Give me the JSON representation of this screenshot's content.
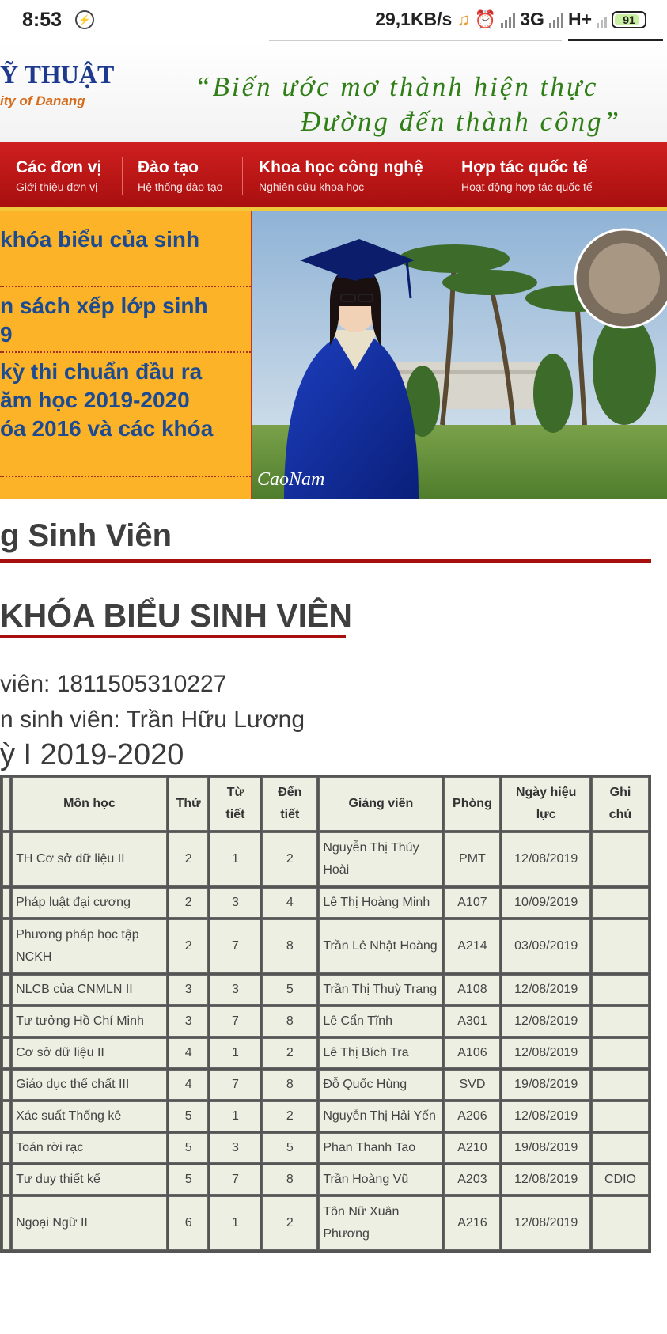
{
  "status_bar": {
    "time": "8:53",
    "network_speed": "29,1KB/s",
    "net_3g": "3G",
    "net_hplus": "H+",
    "battery": "91"
  },
  "header": {
    "logo_title": "Ỹ THUẬT",
    "logo_subtitle": "ity of Danang",
    "slogan_line1": "“Biến ước mơ thành hiện thực",
    "slogan_line2": "Đường đến thành công”"
  },
  "nav": {
    "items": [
      {
        "title": "Các đơn vị",
        "subtitle": "Giới thiệu đơn vị"
      },
      {
        "title": "Đào tạo",
        "subtitle": "Hệ thống đào tạo"
      },
      {
        "title": "Khoa học công nghệ",
        "subtitle": "Nghiên cứu khoa học"
      },
      {
        "title": "Hợp tác quốc tế",
        "subtitle": "Hoạt động hợp tác quốc tế"
      }
    ]
  },
  "news": {
    "items": [
      {
        "line1": "khóa biểu của sinh"
      },
      {
        "line1": "n sách xếp lớp sinh",
        "line2": "9"
      },
      {
        "line1": "kỳ thi chuẩn đầu ra",
        "line2": "ăm học 2019-2020",
        "line3": "óa 2016 và các khóa"
      }
    ]
  },
  "photo": {
    "watermark": "CaoNam"
  },
  "section": {
    "title": "g Sinh Viên"
  },
  "schedule": {
    "title": "KHÓA BIỂU SINH VIÊN",
    "student_id_line": " viên: 1811505310227",
    "student_name_line": "n sinh viên: Trần Hữu  Lương",
    "semester_line": "ỳ I 2019-2020",
    "headers": {
      "subject": "Môn học",
      "day": "Thứ",
      "from_period_1": "Từ",
      "from_period_2": "tiết",
      "to_period_1": "Đến",
      "to_period_2": "tiết",
      "lecturer": "Giảng viên",
      "room": "Phòng",
      "effective_1": "Ngày hiệu",
      "effective_2": "lực",
      "note_1": "Ghi",
      "note_2": "chú"
    },
    "rows": [
      {
        "subject": "TH Cơ sở dữ liệu II",
        "day": "2",
        "from": "1",
        "to": "2",
        "lecturer": "Nguyễn Thị Thúy Hoài",
        "room": "PMT",
        "date": "12/08/2019",
        "note": ""
      },
      {
        "subject": "Pháp luật đại cương",
        "day": "2",
        "from": "3",
        "to": "4",
        "lecturer": "Lê Thị Hoàng Minh",
        "room": "A107",
        "date": "10/09/2019",
        "note": ""
      },
      {
        "subject": "Phương pháp học tập NCKH",
        "day": "2",
        "from": "7",
        "to": "8",
        "lecturer": "Trần Lê Nhật Hoàng",
        "room": "A214",
        "date": "03/09/2019",
        "note": ""
      },
      {
        "subject": "NLCB của CNMLN II",
        "day": "3",
        "from": "3",
        "to": "5",
        "lecturer": "Trần Thị Thuỳ Trang",
        "room": "A108",
        "date": "12/08/2019",
        "note": ""
      },
      {
        "subject": "Tư tưởng Hồ Chí Minh",
        "day": "3",
        "from": "7",
        "to": "8",
        "lecturer": "Lê Cẩn Tĩnh",
        "room": "A301",
        "date": "12/08/2019",
        "note": ""
      },
      {
        "subject": "Cơ sở dữ liệu II",
        "day": "4",
        "from": "1",
        "to": "2",
        "lecturer": "Lê Thị Bích Tra",
        "room": "A106",
        "date": "12/08/2019",
        "note": ""
      },
      {
        "subject": "Giáo dục thể chất III",
        "day": "4",
        "from": "7",
        "to": "8",
        "lecturer": "Đỗ Quốc Hùng",
        "room": "SVD",
        "date": "19/08/2019",
        "note": ""
      },
      {
        "subject": "Xác suất Thống kê",
        "day": "5",
        "from": "1",
        "to": "2",
        "lecturer": "Nguyễn Thị Hải Yến",
        "room": "A206",
        "date": "12/08/2019",
        "note": ""
      },
      {
        "subject": "Toán rời rạc",
        "day": "5",
        "from": "3",
        "to": "5",
        "lecturer": "Phan Thanh Tao",
        "room": "A210",
        "date": "19/08/2019",
        "note": ""
      },
      {
        "subject": "Tư duy thiết kế",
        "day": "5",
        "from": "7",
        "to": "8",
        "lecturer": "Trần Hoàng Vũ",
        "room": "A203",
        "date": "12/08/2019",
        "note": "CDIO"
      },
      {
        "subject": "Ngoại Ngữ II",
        "day": "6",
        "from": "1",
        "to": "2",
        "lecturer": "Tôn Nữ Xuân Phương",
        "room": "A216",
        "date": "12/08/2019",
        "note": ""
      }
    ]
  }
}
